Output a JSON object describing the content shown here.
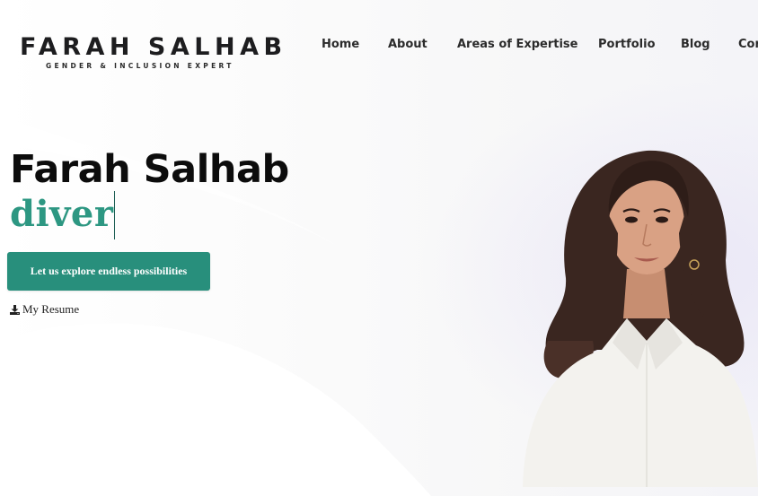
{
  "logo": {
    "name": "FARAH SALHAB",
    "tagline": "GENDER & INCLUSION EXPERT"
  },
  "nav": {
    "items": [
      "Home",
      "About",
      "Areas of Expertise",
      "Portfolio",
      "Blog",
      "Cor"
    ]
  },
  "hero": {
    "name": "Farah Salhab",
    "typed_text": "diver",
    "cta_label": "Let us explore endless possibilities",
    "resume_label": "My Resume"
  },
  "colors": {
    "accent": "#288f7c",
    "typed": "#2d9782",
    "text": "#0c0c0c"
  },
  "icons": {
    "resume": "download-icon"
  }
}
